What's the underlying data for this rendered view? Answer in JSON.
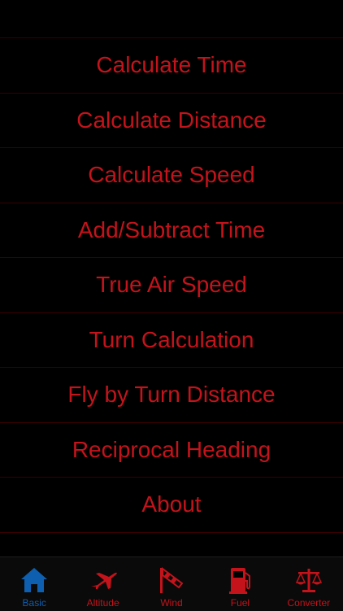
{
  "colors": {
    "accent": "#c4131b",
    "active": "#0e5fb0",
    "background": "#000000",
    "divider": "#3a0000"
  },
  "menu": {
    "items": [
      {
        "label": "Calculate Time"
      },
      {
        "label": "Calculate Distance"
      },
      {
        "label": "Calculate Speed"
      },
      {
        "label": "Add/Subtract Time"
      },
      {
        "label": "True Air Speed"
      },
      {
        "label": "Turn Calculation"
      },
      {
        "label": "Fly by Turn Distance"
      },
      {
        "label": "Reciprocal Heading"
      },
      {
        "label": "About"
      }
    ]
  },
  "tabbar": {
    "tabs": [
      {
        "label": "Basic",
        "icon": "home-icon",
        "active": true
      },
      {
        "label": "Altitude",
        "icon": "airplane-icon",
        "active": false
      },
      {
        "label": "Wind",
        "icon": "windsock-icon",
        "active": false
      },
      {
        "label": "Fuel",
        "icon": "fuel-pump-icon",
        "active": false
      },
      {
        "label": "Converter",
        "icon": "scale-icon",
        "active": false
      }
    ]
  }
}
